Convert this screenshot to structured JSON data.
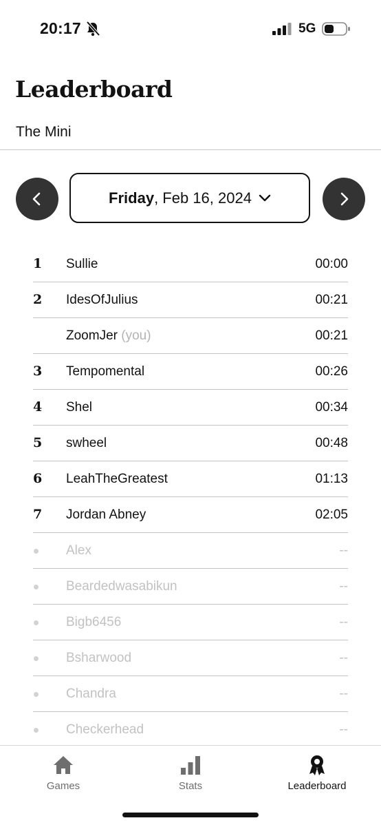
{
  "status_bar": {
    "time": "20:17",
    "network": "5G"
  },
  "header": {
    "title": "Leaderboard",
    "subtitle": "The Mini"
  },
  "date_selector": {
    "day": "Friday",
    "rest": ", Feb 16, 2024"
  },
  "rows": [
    {
      "rank": "1",
      "name": "Sullie",
      "you": "",
      "time": "00:00"
    },
    {
      "rank": "2",
      "name": "IdesOfJulius",
      "you": "",
      "time": "00:21"
    },
    {
      "rank": "",
      "name": "ZoomJer",
      "you": "(you)",
      "time": "00:21"
    },
    {
      "rank": "3",
      "name": "Tempomental",
      "you": "",
      "time": "00:26"
    },
    {
      "rank": "4",
      "name": "Shel",
      "you": "",
      "time": "00:34"
    },
    {
      "rank": "5",
      "name": "swheel",
      "you": "",
      "time": "00:48"
    },
    {
      "rank": "6",
      "name": "LeahTheGreatest",
      "you": "",
      "time": "01:13"
    },
    {
      "rank": "7",
      "name": "Jordan Abney",
      "you": "",
      "time": "02:05"
    },
    {
      "rank": "",
      "name": "Alex",
      "you": "",
      "time": "--"
    },
    {
      "rank": "",
      "name": "Beardedwasabikun",
      "you": "",
      "time": "--"
    },
    {
      "rank": "",
      "name": "Bigb6456",
      "you": "",
      "time": "--"
    },
    {
      "rank": "",
      "name": "Bsharwood",
      "you": "",
      "time": "--"
    },
    {
      "rank": "",
      "name": "Chandra",
      "you": "",
      "time": "--"
    },
    {
      "rank": "",
      "name": "Checkerhead",
      "you": "",
      "time": "--"
    }
  ],
  "tab_bar": {
    "tabs": [
      {
        "label": "Games",
        "icon": "home-icon"
      },
      {
        "label": "Stats",
        "icon": "bar-chart-icon"
      },
      {
        "label": "Leaderboard",
        "icon": "award-ribbon-icon",
        "active": true
      }
    ]
  },
  "colors": {
    "text": "#121212",
    "nav_button": "#333333",
    "inactive_text": "#c2c2c2",
    "divider": "#c4c4c4"
  }
}
